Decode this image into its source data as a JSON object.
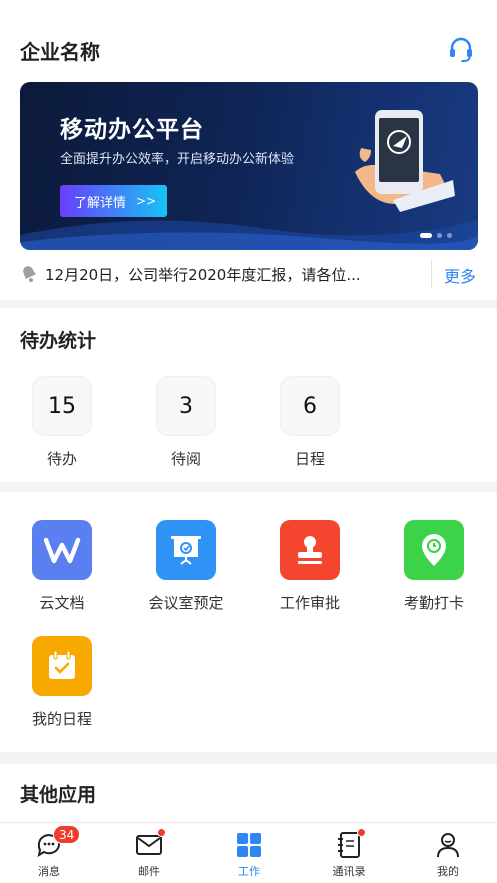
{
  "header": {
    "company_name": "企业名称"
  },
  "banner": {
    "title": "移动办公平台",
    "subtitle": "全面提升办公效率，开启移动办公新体验",
    "button_label": "了解详情",
    "button_arrow": ">>",
    "page_count": 3,
    "active_page": 1
  },
  "notice": {
    "text": "12月20日，公司举行2020年度汇报，请各位...",
    "more_label": "更多"
  },
  "todo": {
    "title": "待办统计",
    "items": [
      {
        "count": "15",
        "label": "待办"
      },
      {
        "count": "3",
        "label": "待阅"
      },
      {
        "count": "6",
        "label": "日程"
      }
    ]
  },
  "apps": {
    "items": [
      {
        "label": "云文档",
        "icon": "wps-icon",
        "color": "#5a7ff0"
      },
      {
        "label": "会议室预定",
        "icon": "projector-icon",
        "color": "#2f93f6"
      },
      {
        "label": "工作审批",
        "icon": "stamp-icon",
        "color": "#f4462f"
      },
      {
        "label": "考勤打卡",
        "icon": "location-icon",
        "color": "#3cd24a"
      },
      {
        "label": "我的日程",
        "icon": "calendar-icon",
        "color": "#f8a900"
      }
    ]
  },
  "other": {
    "title": "其他应用"
  },
  "tabbar": {
    "items": [
      {
        "label": "消息",
        "badge": "34"
      },
      {
        "label": "邮件"
      },
      {
        "label": "工作"
      },
      {
        "label": "通讯录"
      },
      {
        "label": "我的"
      }
    ],
    "active": "工作"
  },
  "colors": {
    "accent": "#2e86f5",
    "badge": "#ef3b2c"
  }
}
